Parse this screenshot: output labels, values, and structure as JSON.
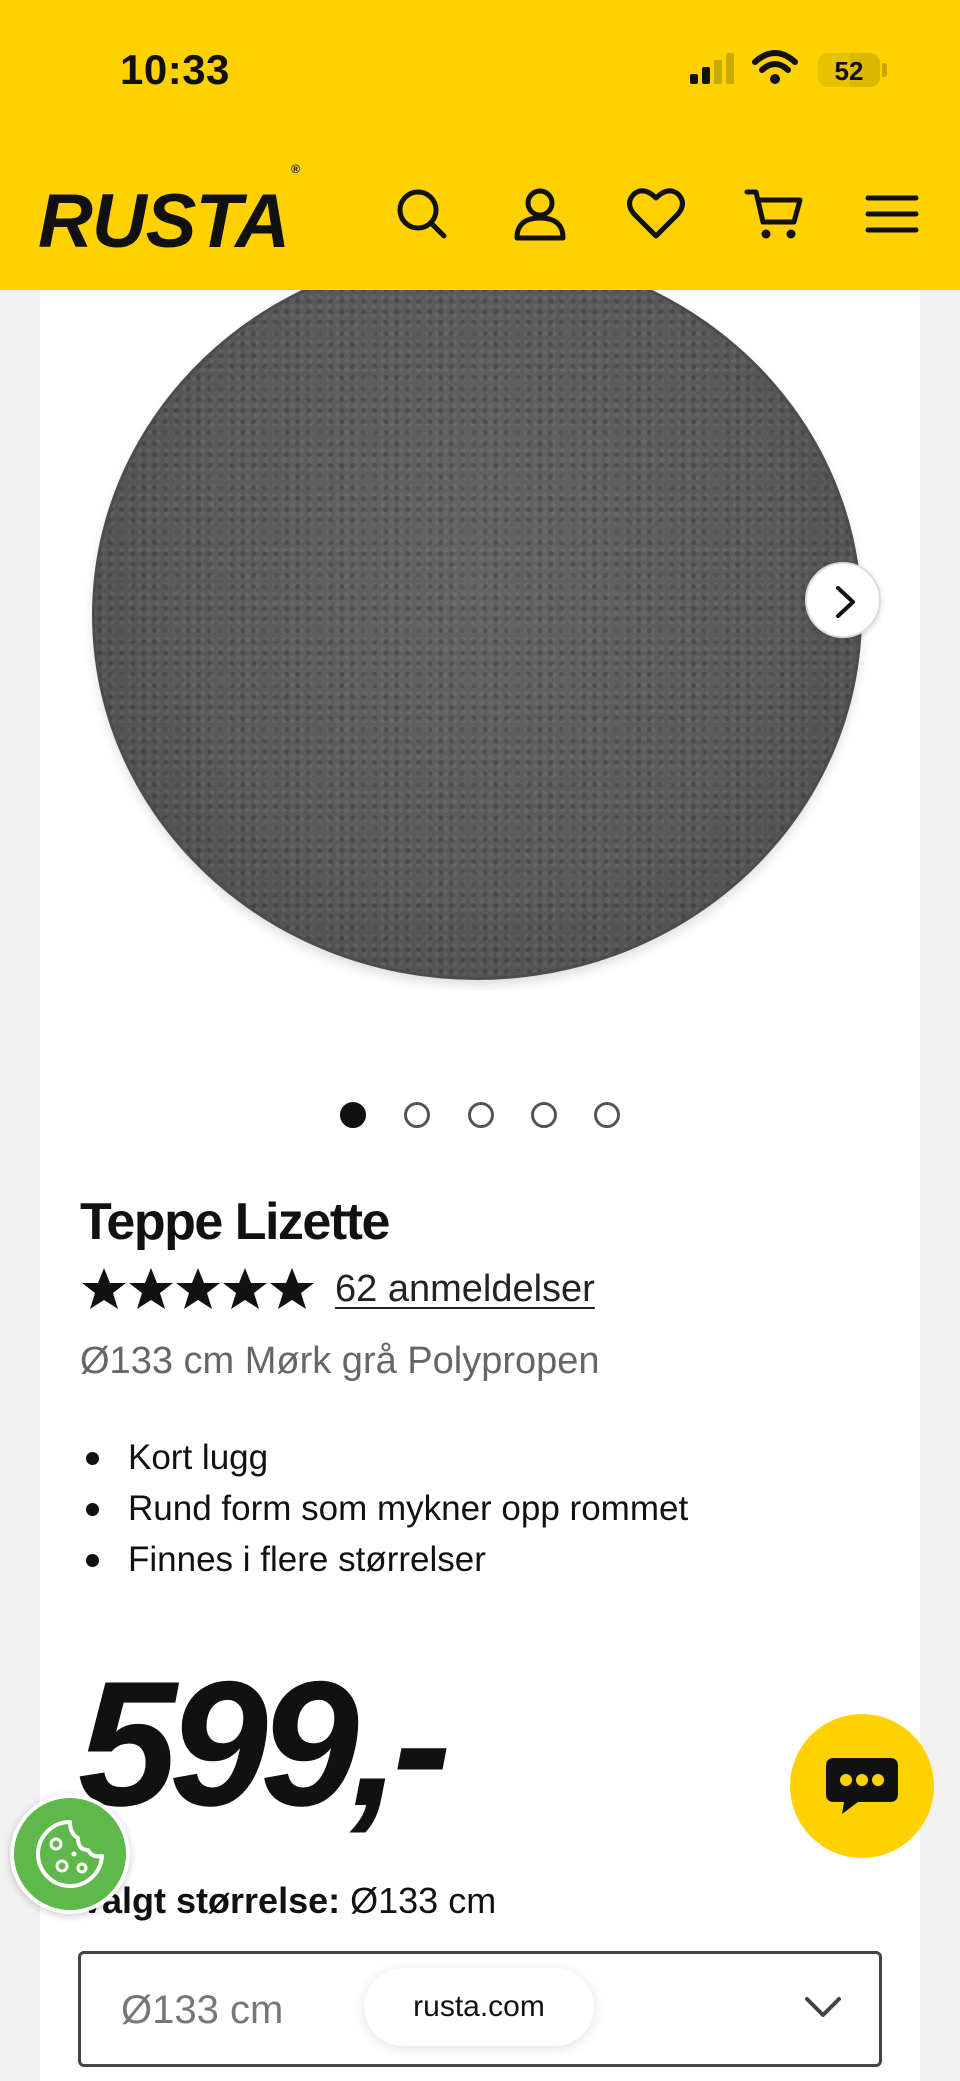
{
  "status_bar": {
    "time": "10:33",
    "battery": "52"
  },
  "header": {
    "logo": "RUSTA",
    "icons": [
      "search-icon",
      "account-icon",
      "heart-icon",
      "cart-icon",
      "menu-icon"
    ],
    "color": "#ffd100"
  },
  "gallery": {
    "slide_count": 5,
    "active_index": 0,
    "next_icon": "chevron-right-icon"
  },
  "product": {
    "title": "Teppe Lizette",
    "rating_stars": 5,
    "reviews": "62 anmeldelser",
    "subtitle": "Ø133 cm Mørk grå Polypropen",
    "features": [
      "Kort lugg",
      "Rund form som mykner opp rommet",
      "Finnes i flere størrelser"
    ],
    "price": "599,-",
    "size_label_prefix": "Valgt størrelse:",
    "size_label_value": "Ø133 cm",
    "size_select_value": "Ø133 cm"
  },
  "browser": {
    "url": "rusta.com"
  },
  "floating": {
    "chat_icon": "chat-icon",
    "cookie_icon": "cookie-icon",
    "chat_color": "#ffd100",
    "cookie_color": "#5fb84a"
  }
}
